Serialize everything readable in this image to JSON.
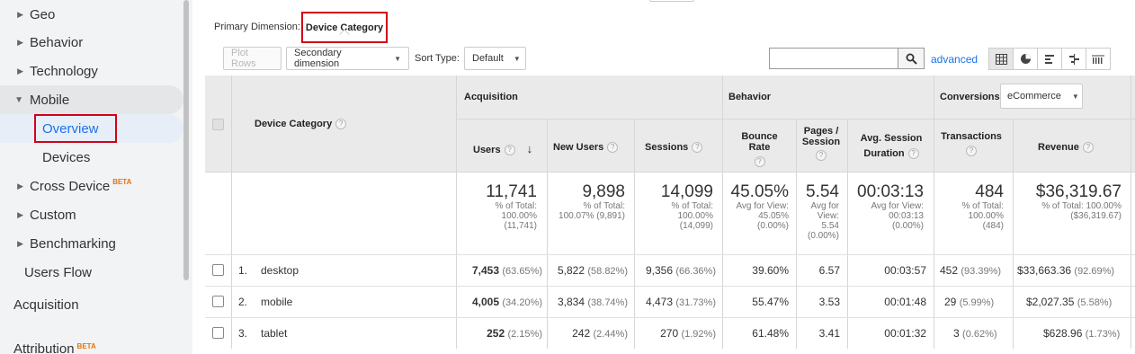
{
  "sidebar": {
    "items": [
      {
        "label": "Geo"
      },
      {
        "label": "Behavior"
      },
      {
        "label": "Technology"
      },
      {
        "label": "Mobile"
      },
      {
        "label": "Cross Device",
        "badge": "BETA"
      },
      {
        "label": "Custom"
      },
      {
        "label": "Benchmarking"
      },
      {
        "label": "Users Flow"
      }
    ],
    "mobile_sub": [
      "Overview",
      "Devices"
    ],
    "sections": [
      "Acquisition",
      "Attribution"
    ],
    "attribution_badge": "BETA"
  },
  "report": {
    "primary_dimension_label": "Primary Dimension:",
    "primary_dimension_value": "Device Category",
    "plot_rows": "Plot Rows",
    "secondary_dimension": "Secondary dimension",
    "sort_type_label": "Sort Type:",
    "sort_type_value": "Default",
    "advanced": "advanced"
  },
  "table": {
    "groups": {
      "acquisition": "Acquisition",
      "behavior": "Behavior",
      "conversions": "Conversions",
      "conversions_dropdown": "eCommerce"
    },
    "dimension_header": "Device Category",
    "columns": {
      "users": "Users",
      "new_users": "New Users",
      "sessions": "Sessions",
      "bounce_rate": "Bounce Rate",
      "pages_session_1": "Pages /",
      "pages_session_2": "Session",
      "avg_duration_1": "Avg. Session",
      "avg_duration_2": "Duration",
      "transactions": "Transactions",
      "revenue": "Revenue"
    },
    "totals": {
      "users": {
        "value": "11,741",
        "l1": "% of Total:",
        "l2": "100.00%",
        "l3": "(11,741)"
      },
      "new_users": {
        "value": "9,898",
        "l1": "% of Total:",
        "l2": "100.07% (9,891)"
      },
      "sessions": {
        "value": "14,099",
        "l1": "% of Total:",
        "l2": "100.00%",
        "l3": "(14,099)"
      },
      "bounce_rate": {
        "value": "45.05%",
        "l1": "Avg for View:",
        "l2": "45.05%",
        "l3": "(0.00%)"
      },
      "pages_session": {
        "value": "5.54",
        "l1": "Avg for",
        "l2": "View:",
        "l3": "5.54",
        "l4": "(0.00%)"
      },
      "avg_duration": {
        "value": "00:03:13",
        "l1": "Avg for View:",
        "l2": "00:03:13",
        "l3": "(0.00%)"
      },
      "transactions": {
        "value": "484",
        "l1": "% of Total:",
        "l2": "100.00%",
        "l3": "(484)"
      },
      "revenue": {
        "value": "$36,319.67",
        "l1": "% of Total: 100.00%",
        "l2": "($36,319.67)"
      }
    },
    "rows": [
      {
        "num": "1.",
        "device": "desktop",
        "users": "7,453",
        "users_pct": "(63.65%)",
        "new_users": "5,822",
        "new_users_pct": "(58.82%)",
        "sessions": "9,356",
        "sessions_pct": "(66.36%)",
        "bounce": "39.60%",
        "pages": "6.57",
        "duration": "00:03:57",
        "transactions": "452",
        "transactions_pct": "(93.39%)",
        "revenue": "$33,663.36",
        "revenue_pct": "(92.69%)"
      },
      {
        "num": "2.",
        "device": "mobile",
        "users": "4,005",
        "users_pct": "(34.20%)",
        "new_users": "3,834",
        "new_users_pct": "(38.74%)",
        "sessions": "4,473",
        "sessions_pct": "(31.73%)",
        "bounce": "55.47%",
        "pages": "3.53",
        "duration": "00:01:48",
        "transactions": "29",
        "transactions_pct": "(5.99%)",
        "revenue": "$2,027.35",
        "revenue_pct": "(5.58%)"
      },
      {
        "num": "3.",
        "device": "tablet",
        "users": "252",
        "users_pct": "(2.15%)",
        "new_users": "242",
        "new_users_pct": "(2.44%)",
        "sessions": "270",
        "sessions_pct": "(1.92%)",
        "bounce": "61.48%",
        "pages": "3.41",
        "duration": "00:01:32",
        "transactions": "3",
        "transactions_pct": "(0.62%)",
        "revenue": "$628.96",
        "revenue_pct": "(1.73%)"
      }
    ]
  }
}
